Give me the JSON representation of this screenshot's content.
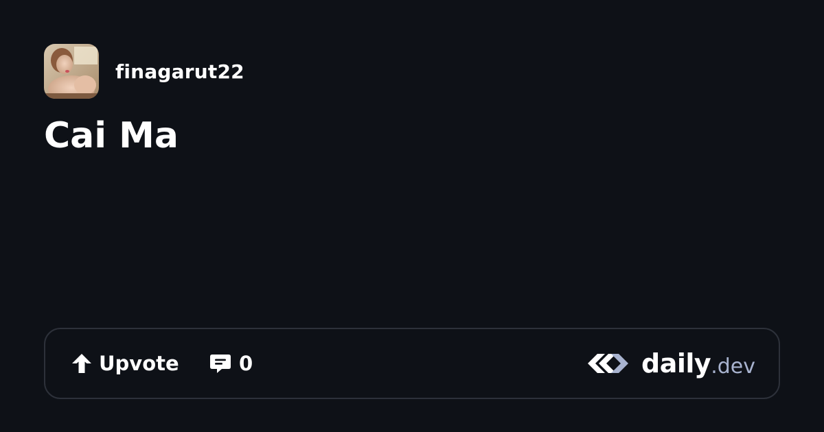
{
  "author": {
    "name": "finagarut22"
  },
  "post": {
    "title": "Cai Ma"
  },
  "actions": {
    "upvote_label": "Upvote",
    "comment_count": "0"
  },
  "brand": {
    "name": "daily",
    "tld": ".dev"
  },
  "icons": {
    "upvote": "arrow-up-icon",
    "comments": "comment-bubble-icon",
    "logo": "daily-dev-logo-icon"
  },
  "colors": {
    "background": "#0e1117",
    "card_border": "#2d313a",
    "text": "#ffffff",
    "muted": "#a8b3cf"
  }
}
